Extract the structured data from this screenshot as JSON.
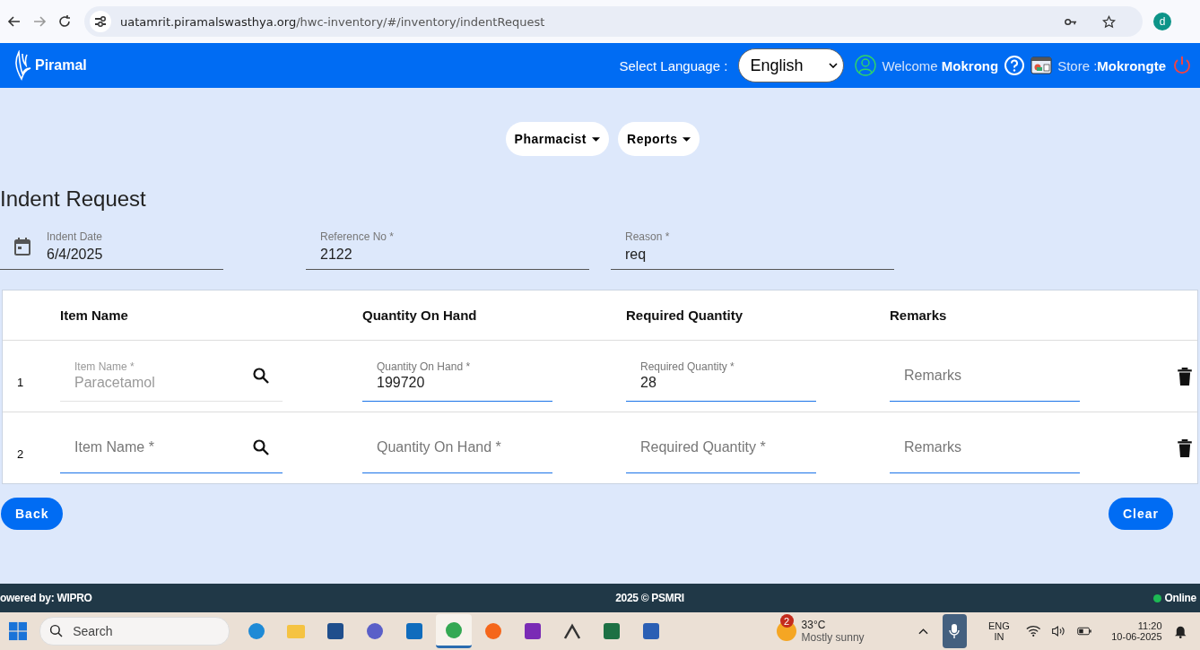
{
  "browser": {
    "url_host": "uatamrit.piramalswasthya.org",
    "url_path": "/hwc-inventory/#/inventory/indentRequest",
    "profile": "d"
  },
  "header": {
    "brand": "Piramal",
    "language_label": "Select Language :",
    "language": "English",
    "welcome": "Welcome",
    "user": "Mokrong",
    "store_label": "Store :",
    "store": "Mokrongte"
  },
  "menus": [
    {
      "label": "Pharmacist"
    },
    {
      "label": "Reports"
    }
  ],
  "page_title": "Indent Request",
  "fields": [
    {
      "kind": "date",
      "label": "Indent Date",
      "value": "6/4/2025"
    },
    {
      "kind": "text",
      "label": "Reference No *",
      "value": "2122"
    },
    {
      "kind": "text",
      "label": "Reason *",
      "value": "req"
    }
  ],
  "table": {
    "columns": [
      "Item Name",
      "Quantity On Hand",
      "Required Quantity",
      "Remarks"
    ],
    "rows": [
      {
        "index": "1",
        "cells": [
          {
            "kind": "search",
            "label": "Item Name *",
            "value": "Paracetamol",
            "disabled": true
          },
          {
            "kind": "text",
            "label": "Quantity On Hand *",
            "value": "199720",
            "disabled": false
          },
          {
            "kind": "text",
            "label": "Required Quantity *",
            "value": "28",
            "disabled": false
          },
          {
            "kind": "text",
            "placeholder": "Remarks",
            "disabled": false
          }
        ]
      },
      {
        "index": "2",
        "cells": [
          {
            "kind": "search",
            "placeholder": "Item Name *",
            "disabled": false
          },
          {
            "kind": "text",
            "placeholder": "Quantity On Hand *",
            "disabled": false
          },
          {
            "kind": "text",
            "placeholder": "Required Quantity *",
            "disabled": false
          },
          {
            "kind": "text",
            "placeholder": "Remarks",
            "disabled": false
          }
        ]
      }
    ]
  },
  "buttons": [
    "Back",
    "Clear"
  ],
  "footer": {
    "left": "owered by: WIPRO",
    "center": "2025 © PSMRI",
    "status": "Online"
  },
  "taskbar": {
    "search": "Search",
    "apps": [
      {
        "kind": "edge",
        "selected": false
      },
      {
        "kind": "files",
        "selected": false
      },
      {
        "kind": "store",
        "selected": false
      },
      {
        "kind": "teams",
        "selected": false
      },
      {
        "kind": "outlook",
        "selected": false
      },
      {
        "kind": "chrome",
        "selected": true
      },
      {
        "kind": "sound",
        "selected": false
      },
      {
        "kind": "onenote",
        "selected": false
      },
      {
        "kind": "people",
        "selected": false
      },
      {
        "kind": "excel",
        "selected": false
      },
      {
        "kind": "word",
        "selected": false
      }
    ],
    "weather_badge": "2",
    "temperature": "33°C",
    "weather": "Mostly sunny",
    "lang_top": "ENG",
    "lang_bottom": "IN",
    "time": "11:20",
    "date": "10-06-2025"
  }
}
